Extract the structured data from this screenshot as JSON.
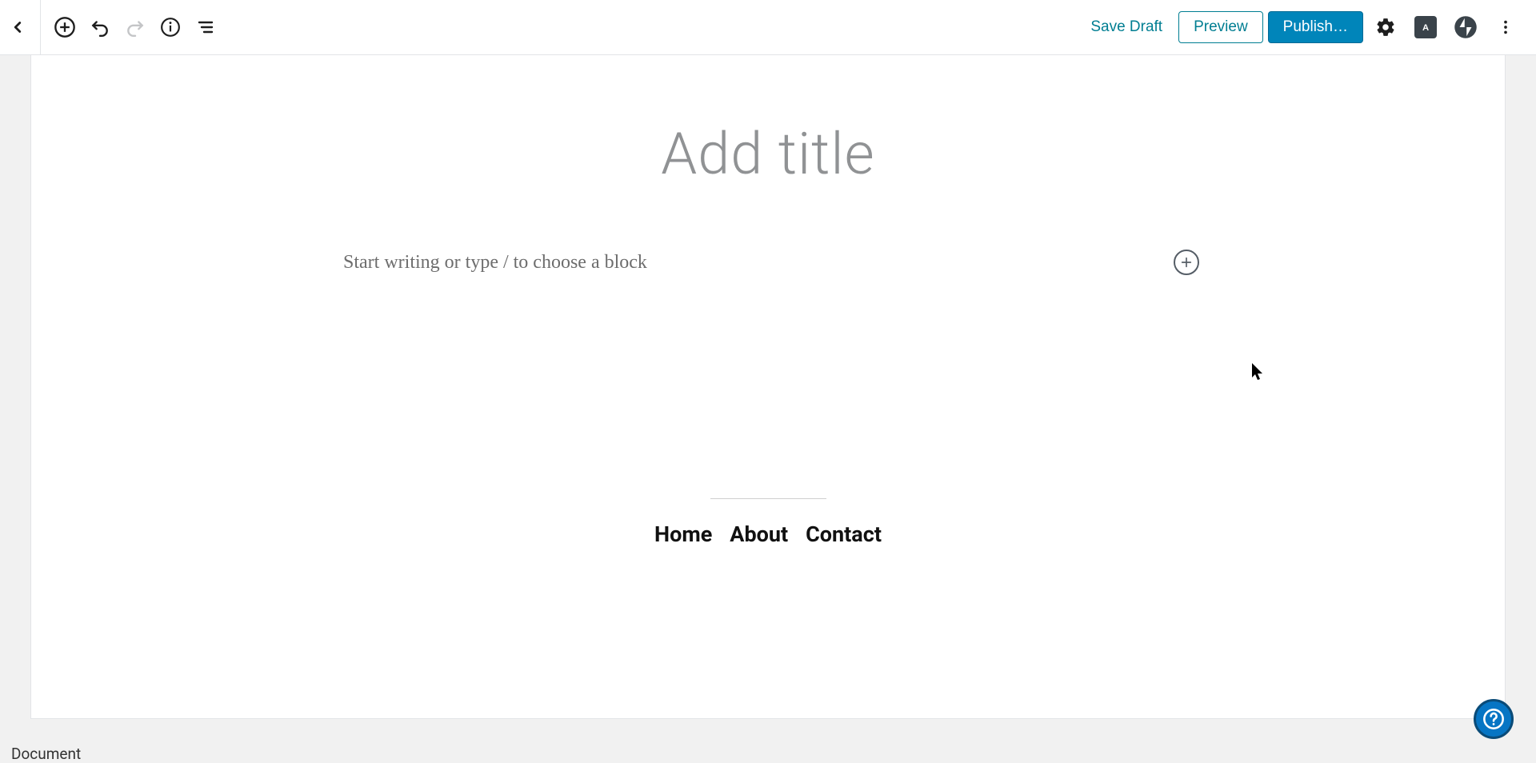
{
  "toolbar": {
    "save_draft": "Save Draft",
    "preview": "Preview",
    "publish": "Publish…"
  },
  "editor": {
    "title_placeholder": "Add title",
    "title_value": "",
    "body_placeholder": "Start writing or type / to choose a block",
    "body_value": ""
  },
  "footer_nav": {
    "items": [
      "Home",
      "About",
      "Contact"
    ]
  },
  "statusbar": {
    "breadcrumb": "Document"
  }
}
